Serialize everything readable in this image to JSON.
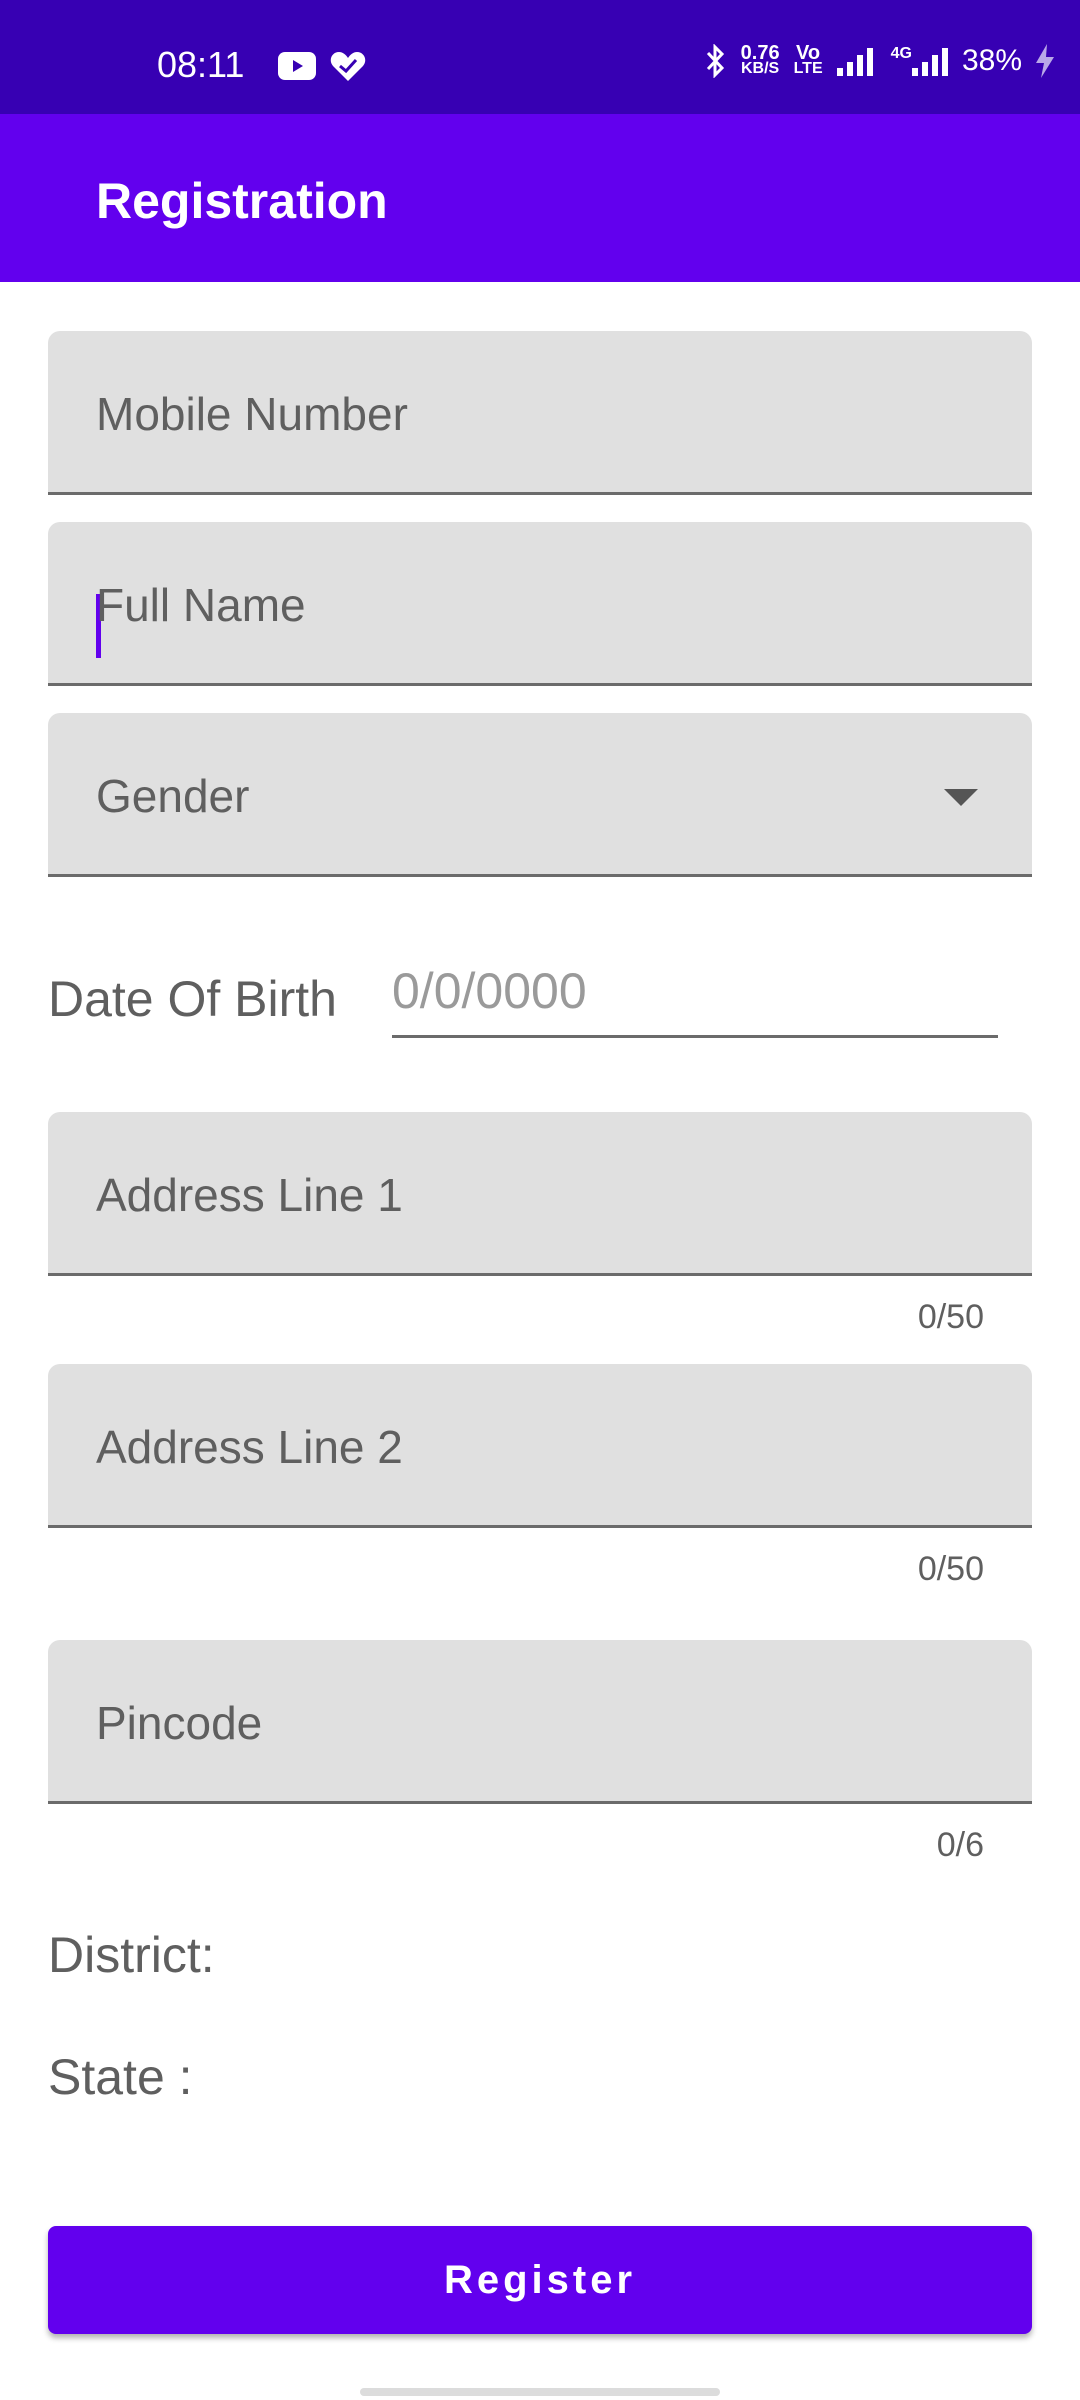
{
  "status_bar": {
    "time": "08:11",
    "data_speed": "0.76",
    "data_unit": "KB/S",
    "vo": "Vo",
    "lte": "LTE",
    "network": "4G",
    "battery": "38%",
    "icons": [
      "youtube-icon",
      "heart-icon",
      "bluetooth-icon",
      "signal-icon",
      "signal-4g-icon",
      "charging-icon"
    ]
  },
  "app_bar": {
    "title": "Registration"
  },
  "form": {
    "mobile_label": "Mobile Number",
    "full_name_label": "Full Name",
    "gender_label": "Gender",
    "dob_label": "Date Of Birth",
    "dob_placeholder": "0/0/0000",
    "address1_label": "Address Line 1",
    "address1_counter": "0/50",
    "address2_label": "Address Line 2",
    "address2_counter": "0/50",
    "pincode_label": "Pincode",
    "pincode_counter": "0/6",
    "district_label": "District:",
    "state_label": "State :",
    "register_label": "Register"
  },
  "colors": {
    "status_bar": "#3700b3",
    "primary": "#6200ee",
    "field_bg": "#e0e0e0"
  }
}
